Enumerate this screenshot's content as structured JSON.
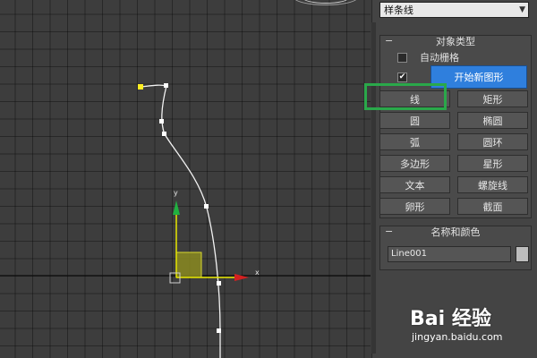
{
  "dropdown": {
    "value": "样条线"
  },
  "object_type": {
    "title": "对象类型",
    "minus": "−",
    "auto_grid": {
      "label": "自动栅格",
      "checked": false
    },
    "start_new": {
      "checked": true,
      "button": "开始新图形"
    },
    "buttons": [
      "线",
      "矩形",
      "圆",
      "椭圆",
      "弧",
      "圆环",
      "多边形",
      "星形",
      "文本",
      "螺旋线",
      "卵形",
      "截面"
    ]
  },
  "name_color": {
    "title": "名称和颜色",
    "minus": "−",
    "name_value": "Line001",
    "color": "#bdbdbd"
  },
  "gizmo": {
    "x_label": "x",
    "y_label": "y"
  },
  "colors": {
    "highlight": "#2aa84a",
    "active_button": "#2f7fdd",
    "x_axis": "#d42020",
    "y_axis": "#20b040",
    "gizmo_plane": "#8a8a20"
  },
  "watermark": {
    "logo": "Bai 经验",
    "url": "jingyan.baidu.com"
  }
}
